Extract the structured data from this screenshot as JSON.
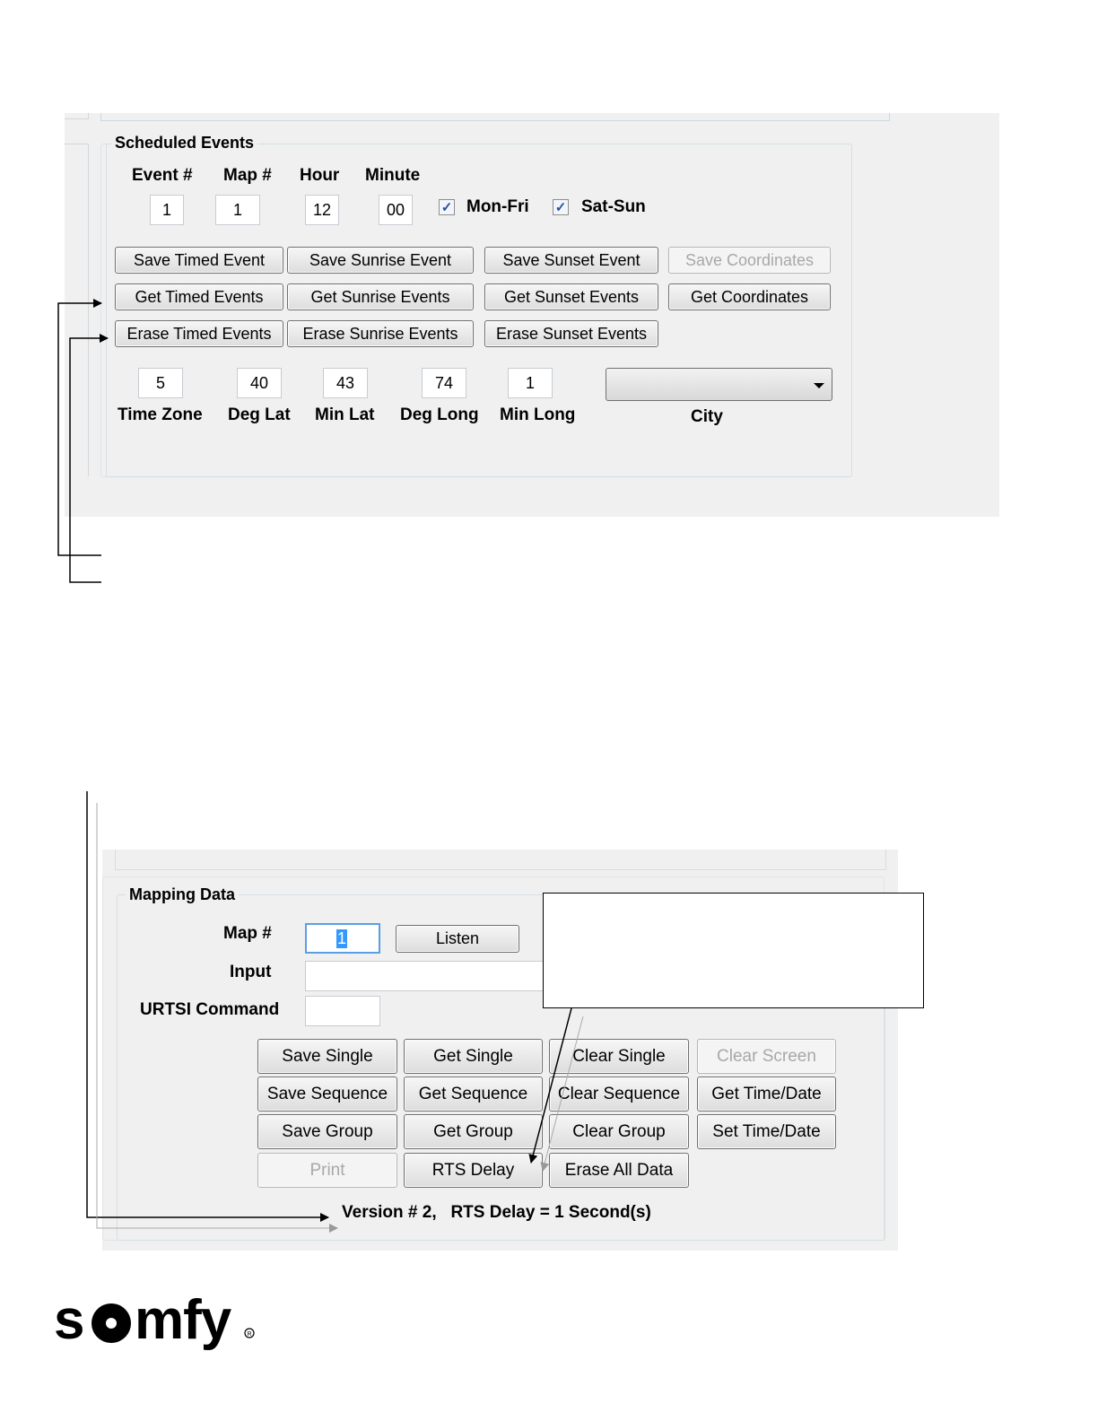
{
  "scheduled": {
    "group_title": "Scheduled Events",
    "headers": {
      "event": "Event #",
      "map": "Map #",
      "hour": "Hour",
      "minute": "Minute"
    },
    "values": {
      "event": "1",
      "map": "1",
      "hour": "12",
      "minute": "00"
    },
    "checkboxes": [
      {
        "label": "Mon-Fri",
        "checked": true
      },
      {
        "label": "Sat-Sun",
        "checked": true
      }
    ],
    "buttons": {
      "save_timed": "Save Timed Event",
      "save_sunrise": "Save Sunrise Event",
      "save_sunset": "Save Sunset Event",
      "save_coordinates": "Save Coordinates",
      "get_timed": "Get Timed Events",
      "get_sunrise": "Get Sunrise Events",
      "get_sunset": "Get Sunset Events",
      "get_coordinates": "Get Coordinates",
      "erase_timed": "Erase Timed Events",
      "erase_sunrise": "Erase Sunrise Events",
      "erase_sunset": "Erase Sunset Events"
    },
    "location": {
      "time_zone": {
        "label": "Time Zone",
        "value": "5"
      },
      "deg_lat": {
        "label": "Deg Lat",
        "value": "40"
      },
      "min_lat": {
        "label": "Min Lat",
        "value": "43"
      },
      "deg_long": {
        "label": "Deg Long",
        "value": "74"
      },
      "min_long": {
        "label": "Min Long",
        "value": "1"
      },
      "city": {
        "label": "City",
        "value": ""
      }
    }
  },
  "mapping": {
    "group_title": "Mapping Data",
    "map_label": "Map #",
    "map_value": "1",
    "listen": "Listen",
    "input_label": "Input",
    "input_value": "",
    "urtsi_label": "URTSI Command",
    "urtsi_value": "",
    "buttons": {
      "save_single": "Save Single",
      "get_single": "Get Single",
      "clear_single": "Clear Single",
      "clear_screen": "Clear Screen",
      "save_sequence": "Save Sequence",
      "get_sequence": "Get Sequence",
      "clear_sequence": "Clear Sequence",
      "get_time_date": "Get Time/Date",
      "save_group": "Save Group",
      "get_group": "Get Group",
      "clear_group": "Clear Group",
      "set_time_date": "Set Time/Date",
      "print": "Print",
      "rts_delay": "RTS Delay",
      "erase_all": "Erase All Data"
    },
    "status": "Version # 2,   RTS Delay = 1 Second(s)"
  },
  "logo": {
    "text": "somfy"
  },
  "colors": {
    "panel_bg": "#f0f0f0",
    "checkbox_check": "#2c4e9b",
    "selection": "#3399ff"
  }
}
